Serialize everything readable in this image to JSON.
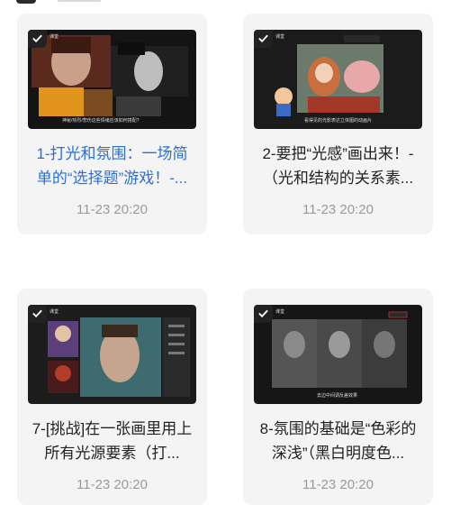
{
  "cards": [
    {
      "title": "1-打光和氛围：一场简单的“选择题”游戏！-...",
      "date": "11-23 20:20",
      "highlight": true,
      "thumb_tag": "课堂",
      "thumb_caption": "神秘/热烈/悲伤这些情绪应该如何搭配?"
    },
    {
      "title": "2-要把“光感”画出来！-（光和结构的关系素...",
      "date": "11-23 20:20",
      "highlight": false,
      "thumb_tag": "课堂",
      "thumb_caption": "看得见的光影表达立体图的动画片"
    },
    {
      "title": "7-[挑战]在一张画里用上所有光源要素（打...",
      "date": "11-23 20:20",
      "highlight": false,
      "thumb_tag": "课堂"
    },
    {
      "title": "8-氛围的基础是“色彩的深浅”（黑白明度色...",
      "date": "11-23 20:20",
      "highlight": false,
      "thumb_tag": "课堂",
      "thumb_caption": "去边中间调反差效果"
    }
  ],
  "icons": {
    "check": "checkmark-icon"
  },
  "colors": {
    "accent": "#2b6fd6",
    "date": "#9a9a9a",
    "card_bg": "#f4f4f4"
  }
}
